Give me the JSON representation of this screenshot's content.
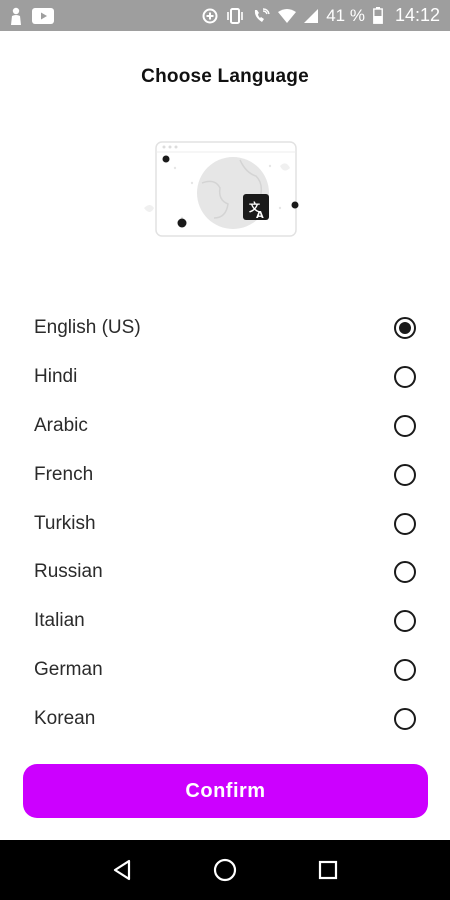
{
  "status_bar": {
    "battery_percent": "41 %",
    "time": "14:12",
    "icons": [
      "person-icon",
      "youtube-icon",
      "data-saver-icon",
      "vibrate-icon",
      "wifi-call-icon",
      "wifi-icon",
      "signal-icon",
      "battery-icon"
    ]
  },
  "page": {
    "title": "Choose Language"
  },
  "languages": [
    {
      "label": "English (US)",
      "selected": true
    },
    {
      "label": "Hindi",
      "selected": false
    },
    {
      "label": "Arabic",
      "selected": false
    },
    {
      "label": "French",
      "selected": false
    },
    {
      "label": "Turkish",
      "selected": false
    },
    {
      "label": "Russian",
      "selected": false
    },
    {
      "label": "Italian",
      "selected": false
    },
    {
      "label": "German",
      "selected": false
    },
    {
      "label": "Korean",
      "selected": false
    }
  ],
  "confirm": {
    "label": "Confirm"
  },
  "colors": {
    "accent": "#cc00ff",
    "status_bar": "#9e9e9e",
    "nav_bar": "#000000"
  },
  "nav_bar": {
    "icons": [
      "back-icon",
      "home-icon",
      "recents-icon"
    ]
  }
}
